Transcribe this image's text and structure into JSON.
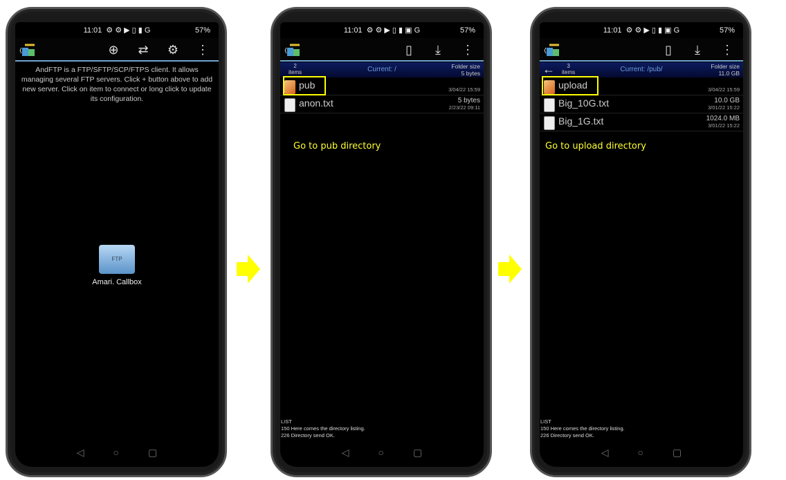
{
  "status": {
    "time": "11:01",
    "battery": "57%"
  },
  "phone1": {
    "intro": "AndFTP is a FTP/SFTP/SCP/FTPS client. It allows managing several FTP servers. Click + button above to add new server. Click on item to connect or long click to update its configuration.",
    "server": {
      "label": "Amari. Callbox",
      "icon_text": "FTP"
    },
    "toolbar_icons": [
      "add-icon",
      "transfer-icon",
      "gear-icon",
      "more-icon"
    ]
  },
  "phone2": {
    "count": "2",
    "items_label": "items",
    "current": "Current: /",
    "folder_size_label": "Folder size",
    "folder_size": "5 bytes",
    "files": [
      {
        "name": "pub",
        "type": "folder",
        "size": "",
        "date": "3/04/22 15:59"
      },
      {
        "name": "anon.txt",
        "type": "file",
        "size": "5 bytes",
        "date": "2/23/22 09:11"
      }
    ],
    "note": "Go to pub directory"
  },
  "phone3": {
    "count": "3",
    "items_label": "items",
    "current": "Current: /pub/",
    "folder_size_label": "Folder size",
    "folder_size": "11.0 GB",
    "files": [
      {
        "name": "upload",
        "type": "folder",
        "size": "",
        "date": "3/04/22 15:59"
      },
      {
        "name": "Big_10G.txt",
        "type": "file",
        "size": "10.0 GB",
        "date": "3/01/22 15:22"
      },
      {
        "name": "Big_1G.txt",
        "type": "file",
        "size": "1024.0 MB",
        "date": "3/01/22 15:22"
      }
    ],
    "note": "Go to upload directory"
  },
  "log": [
    "LIST",
    "150 Here comes the directory listing.",
    "226 Directory send OK."
  ],
  "arrow_color": "#ffff00",
  "highlight_color": "#ffff00"
}
